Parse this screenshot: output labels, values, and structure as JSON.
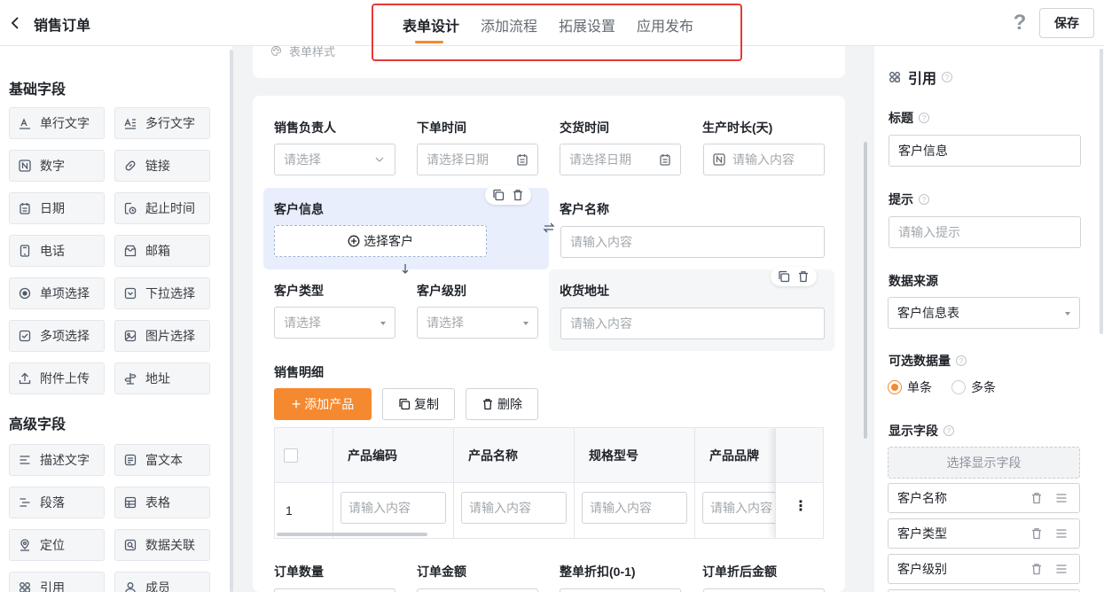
{
  "header": {
    "title": "销售订单",
    "tabs": [
      {
        "label": "表单设计",
        "active": true
      },
      {
        "label": "添加流程",
        "active": false
      },
      {
        "label": "拓展设置",
        "active": false
      },
      {
        "label": "应用发布",
        "active": false
      }
    ],
    "help_label": "?",
    "save_label": "保存"
  },
  "palette": {
    "basic_title": "基础字段",
    "basic_fields": [
      {
        "label": "单行文字",
        "icon": "text-line-icon"
      },
      {
        "label": "多行文字",
        "icon": "text-multi-icon"
      },
      {
        "label": "数字",
        "icon": "number-icon"
      },
      {
        "label": "链接",
        "icon": "link-icon"
      },
      {
        "label": "日期",
        "icon": "calendar-icon"
      },
      {
        "label": "起止时间",
        "icon": "time-range-icon"
      },
      {
        "label": "电话",
        "icon": "phone-icon"
      },
      {
        "label": "邮箱",
        "icon": "mail-icon"
      },
      {
        "label": "单项选择",
        "icon": "radio-icon"
      },
      {
        "label": "下拉选择",
        "icon": "dropdown-icon"
      },
      {
        "label": "多项选择",
        "icon": "checkbox-icon"
      },
      {
        "label": "图片选择",
        "icon": "image-icon"
      },
      {
        "label": "附件上传",
        "icon": "upload-icon"
      },
      {
        "label": "地址",
        "icon": "signpost-icon"
      }
    ],
    "advanced_title": "高级字段",
    "advanced_fields": [
      {
        "label": "描述文字",
        "icon": "description-icon"
      },
      {
        "label": "富文本",
        "icon": "rich-text-icon"
      },
      {
        "label": "段落",
        "icon": "paragraph-icon"
      },
      {
        "label": "表格",
        "icon": "table-icon"
      },
      {
        "label": "定位",
        "icon": "location-icon"
      },
      {
        "label": "数据关联",
        "icon": "data-link-icon"
      },
      {
        "label": "引用",
        "icon": "reference-icon"
      },
      {
        "label": "成员",
        "icon": "member-icon"
      }
    ]
  },
  "canvas": {
    "style_link": "表单样式",
    "row1": [
      {
        "label": "销售负责人",
        "placeholder": "请选择",
        "kind": "select"
      },
      {
        "label": "下单时间",
        "placeholder": "请选择日期",
        "kind": "date"
      },
      {
        "label": "交货时间",
        "placeholder": "请选择日期",
        "kind": "date"
      },
      {
        "label": "生产时长(天)",
        "placeholder": "请输入内容",
        "kind": "number"
      }
    ],
    "customer_info": {
      "label": "客户信息",
      "button": "选择客户"
    },
    "customer_name": {
      "label": "客户名称",
      "placeholder": "请输入内容"
    },
    "customer_type": {
      "label": "客户类型",
      "placeholder": "请选择"
    },
    "customer_level": {
      "label": "客户级别",
      "placeholder": "请选择"
    },
    "address": {
      "label": "收货地址",
      "placeholder": "请输入内容"
    },
    "detail": {
      "label": "销售明细",
      "add_button": "添加产品",
      "add_icon": "+",
      "copy_button": "复制",
      "delete_button": "删除",
      "columns": [
        "产品编码",
        "产品名称",
        "规格型号",
        "产品品牌"
      ],
      "rows": [
        {
          "index": "1",
          "cells": [
            "请输入内容",
            "请输入内容",
            "请输入内容",
            "请输入内容"
          ]
        }
      ],
      "more_glyph": "⋮"
    },
    "row_bottom": [
      {
        "label": "订单数量"
      },
      {
        "label": "订单金额"
      },
      {
        "label": "整单折扣(0-1)"
      },
      {
        "label": "订单折后金额"
      }
    ]
  },
  "props": {
    "title": "引用",
    "title_label": "标题",
    "title_value": "客户信息",
    "hint_label": "提示",
    "hint_placeholder": "请输入提示",
    "source_label": "数据来源",
    "source_value": "客户信息表",
    "count_label": "可选数据量",
    "count_options": [
      {
        "label": "单条",
        "selected": true
      },
      {
        "label": "多条",
        "selected": false
      }
    ],
    "display_label": "显示字段",
    "display_button": "选择显示字段",
    "display_fields": [
      "客户名称",
      "客户类型",
      "客户级别"
    ]
  },
  "colors": {
    "accent": "#f5892f",
    "highlight_box": "#e53935",
    "selected_bg": "#e8eefc"
  }
}
